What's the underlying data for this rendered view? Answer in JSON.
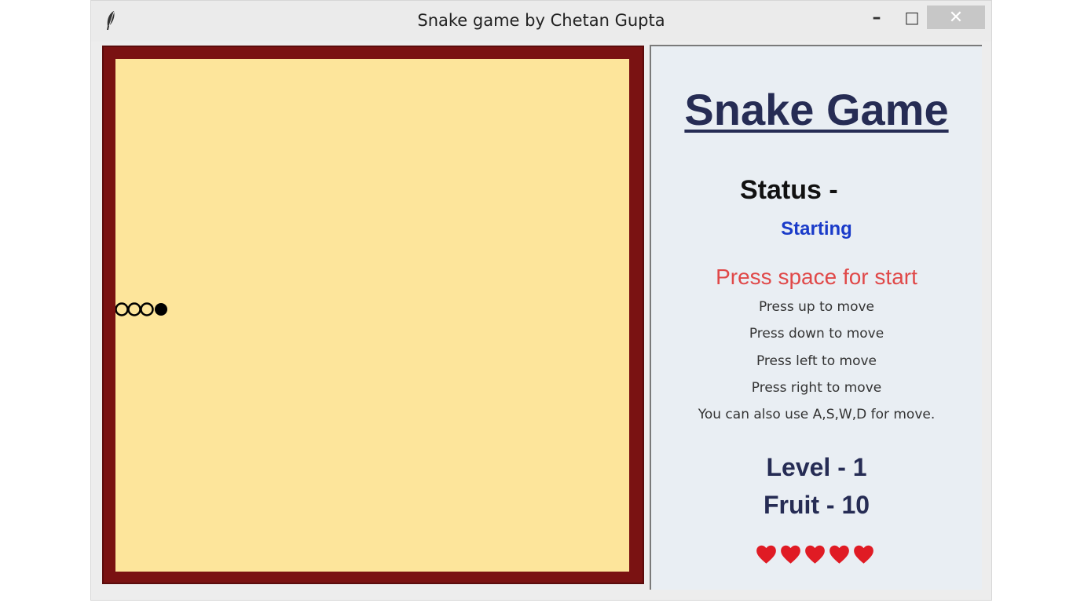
{
  "window": {
    "title": "Snake game by Chetan Gupta",
    "minimize_label": "–",
    "maximize_label": "□",
    "close_label": "✕"
  },
  "panel": {
    "title": "Snake Game",
    "status_label": "Status -",
    "status_value": "Starting",
    "press_start": "Press space for start",
    "help": [
      "Press up to move",
      "Press down to move",
      "Press left to move",
      "Press right to move",
      "You can also use A,S,W,D for move."
    ],
    "level_text": "Level -  1",
    "fruit_text": "Fruit -  10",
    "lives": 5
  },
  "colors": {
    "board": "#fde59b",
    "border": "#7a1212",
    "heart": "#e01b24",
    "title": "#262c54",
    "status": "#1a3bc9",
    "press": "#e04848"
  },
  "icons": {
    "app": "feather-icon",
    "heart": "heart-icon"
  },
  "snake": {
    "segments": 4,
    "head": "filled",
    "direction": "right"
  }
}
